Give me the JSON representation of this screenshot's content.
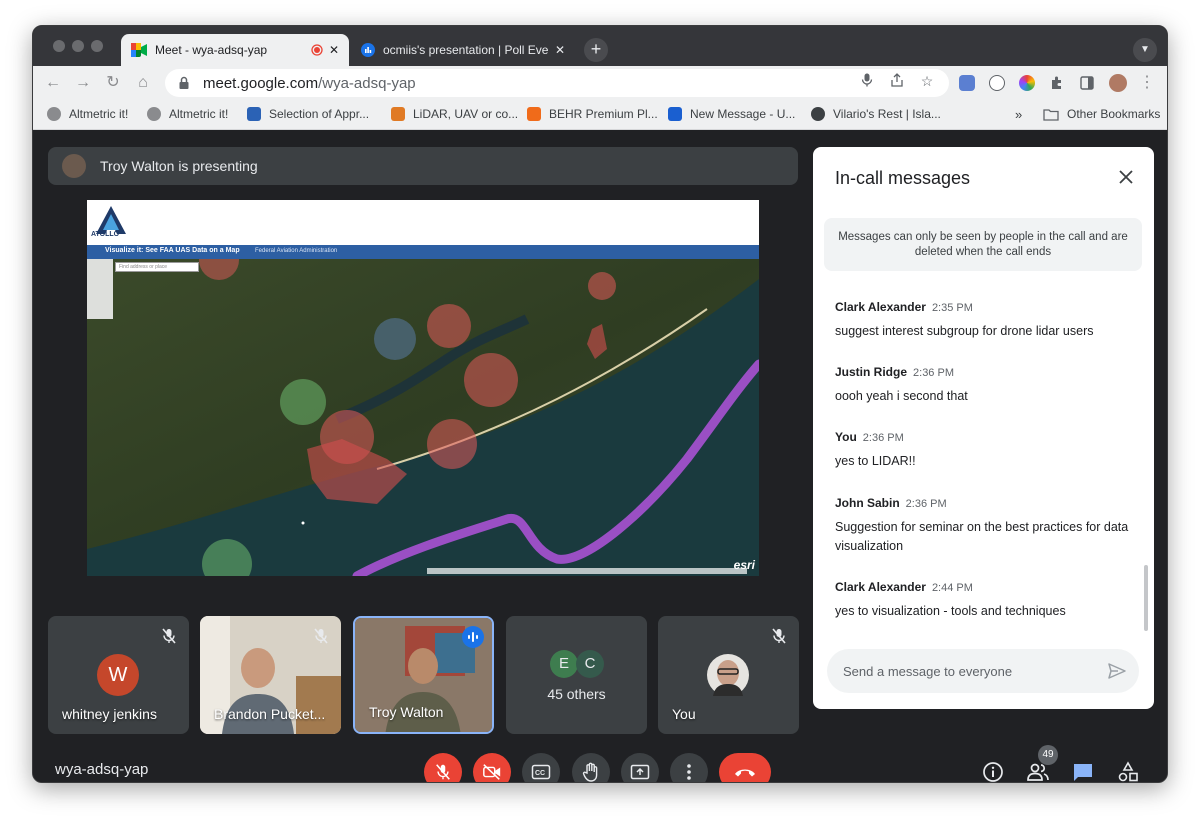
{
  "browser": {
    "tabs": [
      {
        "title": "Meet - wya-adsq-yap"
      },
      {
        "title": "ocmiis's presentation | Poll Eve"
      }
    ],
    "url_host": "meet.google.com",
    "url_path": "/wya-adsq-yap",
    "bookmarks": [
      {
        "label": "Altmetric it!"
      },
      {
        "label": "Altmetric it!"
      },
      {
        "label": "Selection of Appr..."
      },
      {
        "label": "LiDAR, UAV or co..."
      },
      {
        "label": "BEHR Premium Pl..."
      },
      {
        "label": "New Message - U..."
      },
      {
        "label": "Vilario's Rest | Isla..."
      }
    ],
    "bookmarks_overflow": "»",
    "other_bookmarks": "Other Bookmarks"
  },
  "meet": {
    "presenting_text": "Troy Walton is presenting",
    "meeting_code": "wya-adsq-yap",
    "participant_count": "49",
    "screen": {
      "logo_text": "ATOLLO",
      "map_title": "Visualize it: See FAA UAS Data on a Map",
      "map_subtitle": "Federal Aviation Administration",
      "search_placeholder": "Find address or place",
      "esri": "esri"
    },
    "tiles": [
      {
        "name": "whitney jenkins",
        "initial": "W"
      },
      {
        "name": "Brandon Pucket..."
      },
      {
        "name": "Troy Walton"
      },
      {
        "others_label": "45 others",
        "initials": [
          "E",
          "C"
        ]
      },
      {
        "name": "You"
      }
    ]
  },
  "chat": {
    "title": "In-call messages",
    "notice": "Messages can only be seen by people in the call and are deleted when the call ends",
    "messages": [
      {
        "sender": "Clark Alexander",
        "time": "2:35 PM",
        "text": "suggest interest subgroup for drone lidar users"
      },
      {
        "sender": "Justin Ridge",
        "time": "2:36 PM",
        "text": "oooh yeah i second that"
      },
      {
        "sender": "You",
        "time": "2:36 PM",
        "text": "yes to LIDAR!!"
      },
      {
        "sender": "John Sabin",
        "time": "2:36 PM",
        "text": "Suggestion for seminar on the best practices for data visualization"
      },
      {
        "sender": "Clark Alexander",
        "time": "2:44 PM",
        "text": "yes to visualization - tools and techniques"
      }
    ],
    "input_placeholder": "Send a message to everyone"
  },
  "colors": {
    "accent_blue": "#8ab4f8",
    "danger_red": "#ea4335",
    "surface": "#3c4043",
    "background": "#202124"
  }
}
